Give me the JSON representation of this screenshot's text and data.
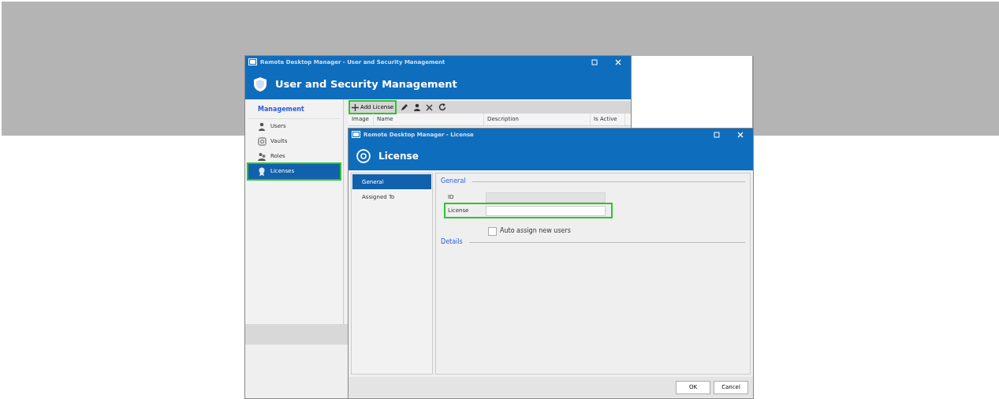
{
  "back_window": {
    "title": "Remote Desktop Manager - User and Security Management",
    "header": "User and Security Management",
    "sidebar": {
      "section": "Management",
      "items": [
        {
          "label": "Users",
          "kind": "user",
          "selected": false,
          "highlighted": false
        },
        {
          "label": "Vaults",
          "kind": "vault",
          "selected": false,
          "highlighted": false
        },
        {
          "label": "Roles",
          "kind": "roles",
          "selected": false,
          "highlighted": false
        },
        {
          "label": "Licenses",
          "kind": "license",
          "selected": true,
          "highlighted": true
        }
      ]
    },
    "toolbar": {
      "add_button": {
        "label": "Add License",
        "highlighted": true
      }
    },
    "table": {
      "columns": [
        "Image",
        "Name",
        "Description",
        "Is Active"
      ]
    }
  },
  "dialog": {
    "title": "Remote Desktop Manager - License",
    "header": "License",
    "nav": [
      {
        "label": "General",
        "selected": true
      },
      {
        "label": "Assigned To",
        "selected": false
      }
    ],
    "sections": [
      {
        "title": "General"
      },
      {
        "title": "Details"
      }
    ],
    "fields": [
      {
        "label": "ID",
        "disabled": true,
        "highlighted": false
      },
      {
        "label": "License",
        "disabled": false,
        "highlighted": true
      }
    ],
    "checkbox": {
      "label": "Auto assign new users",
      "checked": false
    },
    "buttons": [
      "OK",
      "Cancel"
    ]
  }
}
